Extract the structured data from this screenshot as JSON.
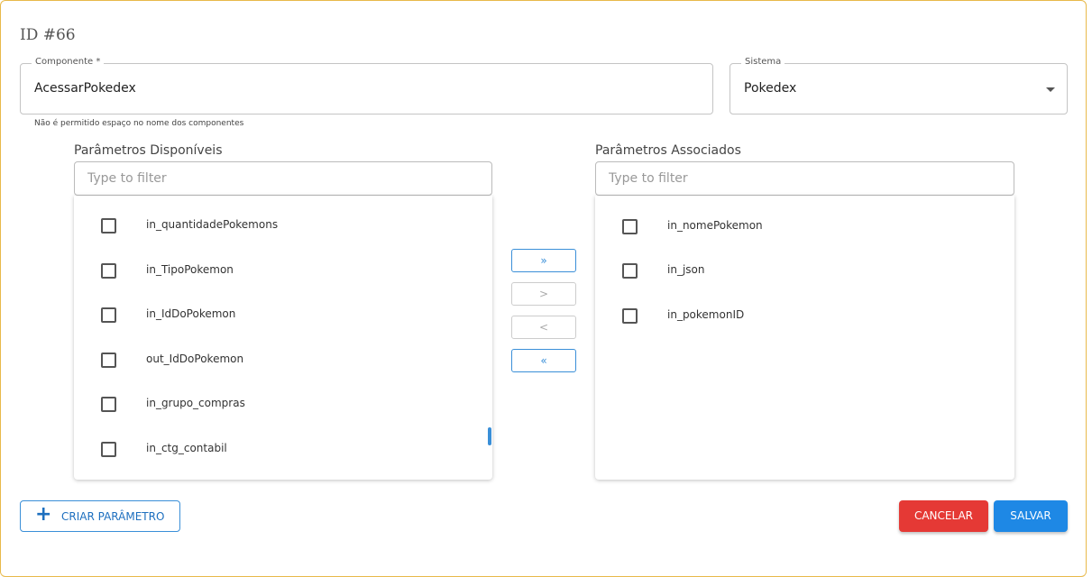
{
  "header": {
    "title": "ID #66"
  },
  "form": {
    "component": {
      "label": "Componente *",
      "value": "AcessarPokedex",
      "helper": "Não é permitido espaço no nome dos componentes"
    },
    "system": {
      "label": "Sistema",
      "value": "Pokedex"
    }
  },
  "available": {
    "title": "Parâmetros Disponíveis",
    "filter_placeholder": "Type to filter",
    "items": [
      "in_quantidadePokemons",
      "in_TipoPokemon",
      "in_IdDoPokemon",
      "out_IdDoPokemon",
      "in_grupo_compras",
      "in_ctg_contabil"
    ]
  },
  "associated": {
    "title": "Parâmetros Associados",
    "filter_placeholder": "Type to filter",
    "items": [
      "in_nomePokemon",
      "in_json",
      "in_pokemonID"
    ]
  },
  "transfer": {
    "move_all_right": "»",
    "move_right": ">",
    "move_left": "<",
    "move_all_left": "«"
  },
  "actions": {
    "create_param": "CRIAR PARÂMETRO",
    "cancel": "CANCELAR",
    "save": "SALVAR"
  },
  "colors": {
    "accent": "#3a8fd8",
    "cancel_bg": "#e53935",
    "save_bg": "#1e88e5",
    "card_border": "#e8b94a"
  },
  "icons": {
    "create": "plus-icon",
    "system_dropdown": "caret-down-icon"
  }
}
